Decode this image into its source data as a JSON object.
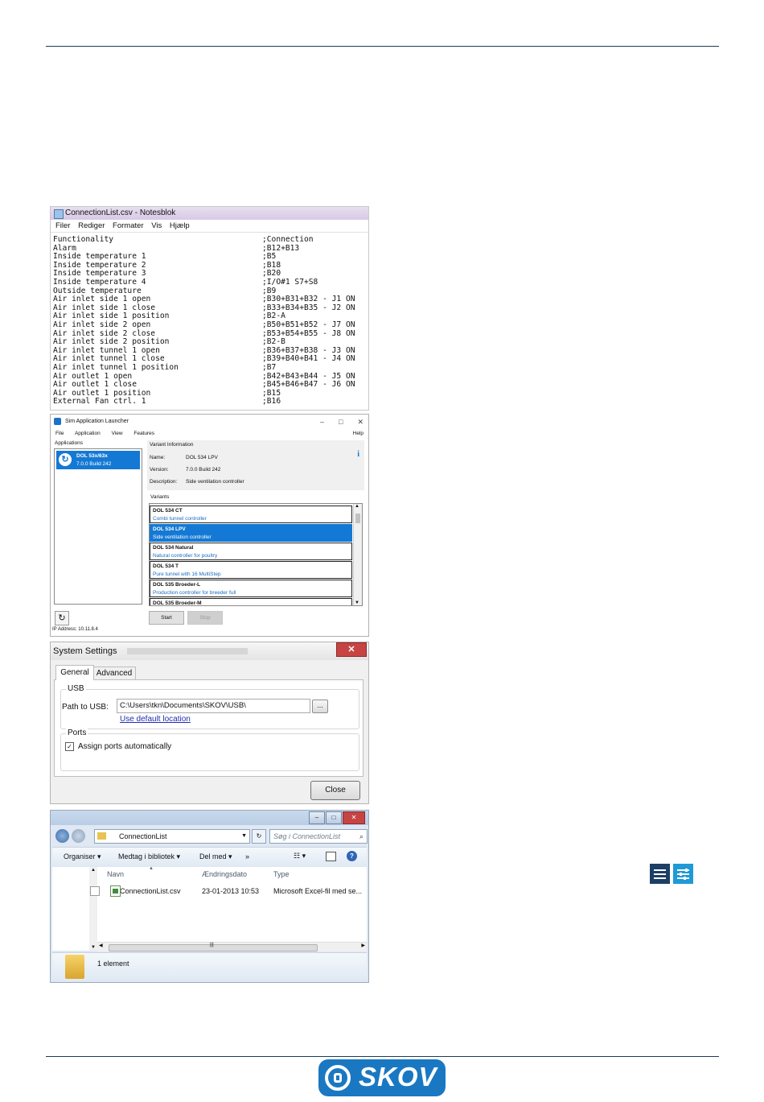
{
  "notepad": {
    "title": "ConnectionList.csv - Notesblok",
    "menu": [
      "Filer",
      "Rediger",
      "Formater",
      "Vis",
      "Hjælp"
    ],
    "rows": [
      {
        "f": "Functionality",
        "c": ";Connection"
      },
      {
        "f": "Alarm",
        "c": ";B12+B13"
      },
      {
        "f": "Inside temperature 1",
        "c": ";B5"
      },
      {
        "f": "Inside temperature 2",
        "c": ";B18"
      },
      {
        "f": "Inside temperature 3",
        "c": ";B20"
      },
      {
        "f": "Inside temperature 4",
        "c": ";I/O#1 S7+S8"
      },
      {
        "f": "Outside temperature",
        "c": ";B9"
      },
      {
        "f": "Air inlet side 1 open",
        "c": ";B30+B31+B32 - J1 ON"
      },
      {
        "f": "Air inlet side 1 close",
        "c": ";B33+B34+B35 - J2 ON"
      },
      {
        "f": "Air inlet side 1 position",
        "c": ";B2-A"
      },
      {
        "f": "Air inlet side 2 open",
        "c": ";B50+B51+B52 - J7 ON"
      },
      {
        "f": "Air inlet side 2 close",
        "c": ";B53+B54+B55 - J8 ON"
      },
      {
        "f": "Air inlet side 2 position",
        "c": ";B2-B"
      },
      {
        "f": "Air inlet tunnel 1 open",
        "c": ";B36+B37+B38 - J3 ON"
      },
      {
        "f": "Air inlet tunnel 1 close",
        "c": ";B39+B40+B41 - J4 ON"
      },
      {
        "f": "Air inlet tunnel 1 position",
        "c": ";B7"
      },
      {
        "f": "Air outlet 1 open",
        "c": ";B42+B43+B44 - J5 ON"
      },
      {
        "f": "Air outlet 1 close",
        "c": ";B45+B46+B47 - J6 ON"
      },
      {
        "f": "Air outlet 1 position",
        "c": ";B15"
      },
      {
        "f": "External Fan ctrl. 1",
        "c": ";B16"
      }
    ]
  },
  "launcher": {
    "title": "Sim Application Launcher",
    "menu": [
      "File",
      "Application",
      "View",
      "Features"
    ],
    "help": "Help",
    "applications_label": "Applications",
    "app_name": "DOL 53x/63x",
    "app_version": "7.0.0 Build 242",
    "variant_info_label": "Variant Information",
    "info": {
      "name_label": "Name:",
      "name": "DOL 534 LPV",
      "version_label": "Version:",
      "version": "7.0.0 Build 242",
      "description_label": "Description:",
      "description": "Side ventilation controller"
    },
    "variants_label": "Variants",
    "variants": [
      {
        "name": "DOL 534 CT",
        "desc": "Combi tunnel controller"
      },
      {
        "name": "DOL 534 LPV",
        "desc": "Side ventilation controller"
      },
      {
        "name": "DOL 534 Natural",
        "desc": "Natural controller for poultry"
      },
      {
        "name": "DOL 534 T",
        "desc": "Pure tunnel with 16 MultiStep"
      },
      {
        "name": "DOL 535 Broeder-L",
        "desc": "Production controller for breeder full"
      },
      {
        "name": "DOL 535 Broeder-M",
        "desc": ""
      }
    ],
    "start": "Start",
    "stop": "Stop",
    "ip": "IP Address:  10.11.8.4"
  },
  "settings": {
    "title": "System Settings",
    "tab_general": "General",
    "tab_advanced": "Advanced",
    "usb_label": "USB",
    "path_label": "Path to USB:",
    "path_value": "C:\\Users\\tkn\\Documents\\SKOV\\USB\\",
    "browse": "...",
    "default_link": "Use default location",
    "ports_label": "Ports",
    "assign_ports": "Assign ports automatically",
    "close": "Close"
  },
  "explorer": {
    "path": "ConnectionList",
    "search_placeholder": "Søg i ConnectionList",
    "toolbar": [
      "Organiser ▾",
      "Medtag i bibliotek ▾",
      "Del med ▾",
      "»"
    ],
    "col_name": "Navn",
    "col_date": "Ændringsdato",
    "col_type": "Type",
    "file_name": "ConnectionList.csv",
    "file_date": "23-01-2013 10:53",
    "file_type": "Microsoft Excel-fil med se...",
    "status": "1 element"
  },
  "logo_text": "SKOV"
}
